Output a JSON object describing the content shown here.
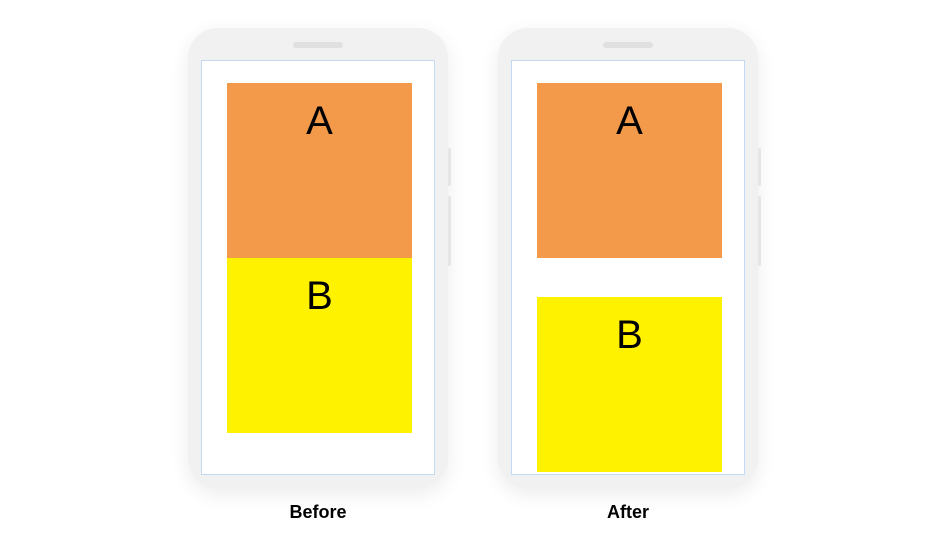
{
  "phones": {
    "before": {
      "caption": "Before",
      "block_a_label": "A",
      "block_b_label": "B"
    },
    "after": {
      "caption": "After",
      "block_a_label": "A",
      "block_b_label": "B"
    }
  },
  "colors": {
    "block_a": "#f2994a",
    "block_b": "#fff200",
    "phone_body": "#f1f1f1",
    "screen_border": "#c5d9f5"
  }
}
